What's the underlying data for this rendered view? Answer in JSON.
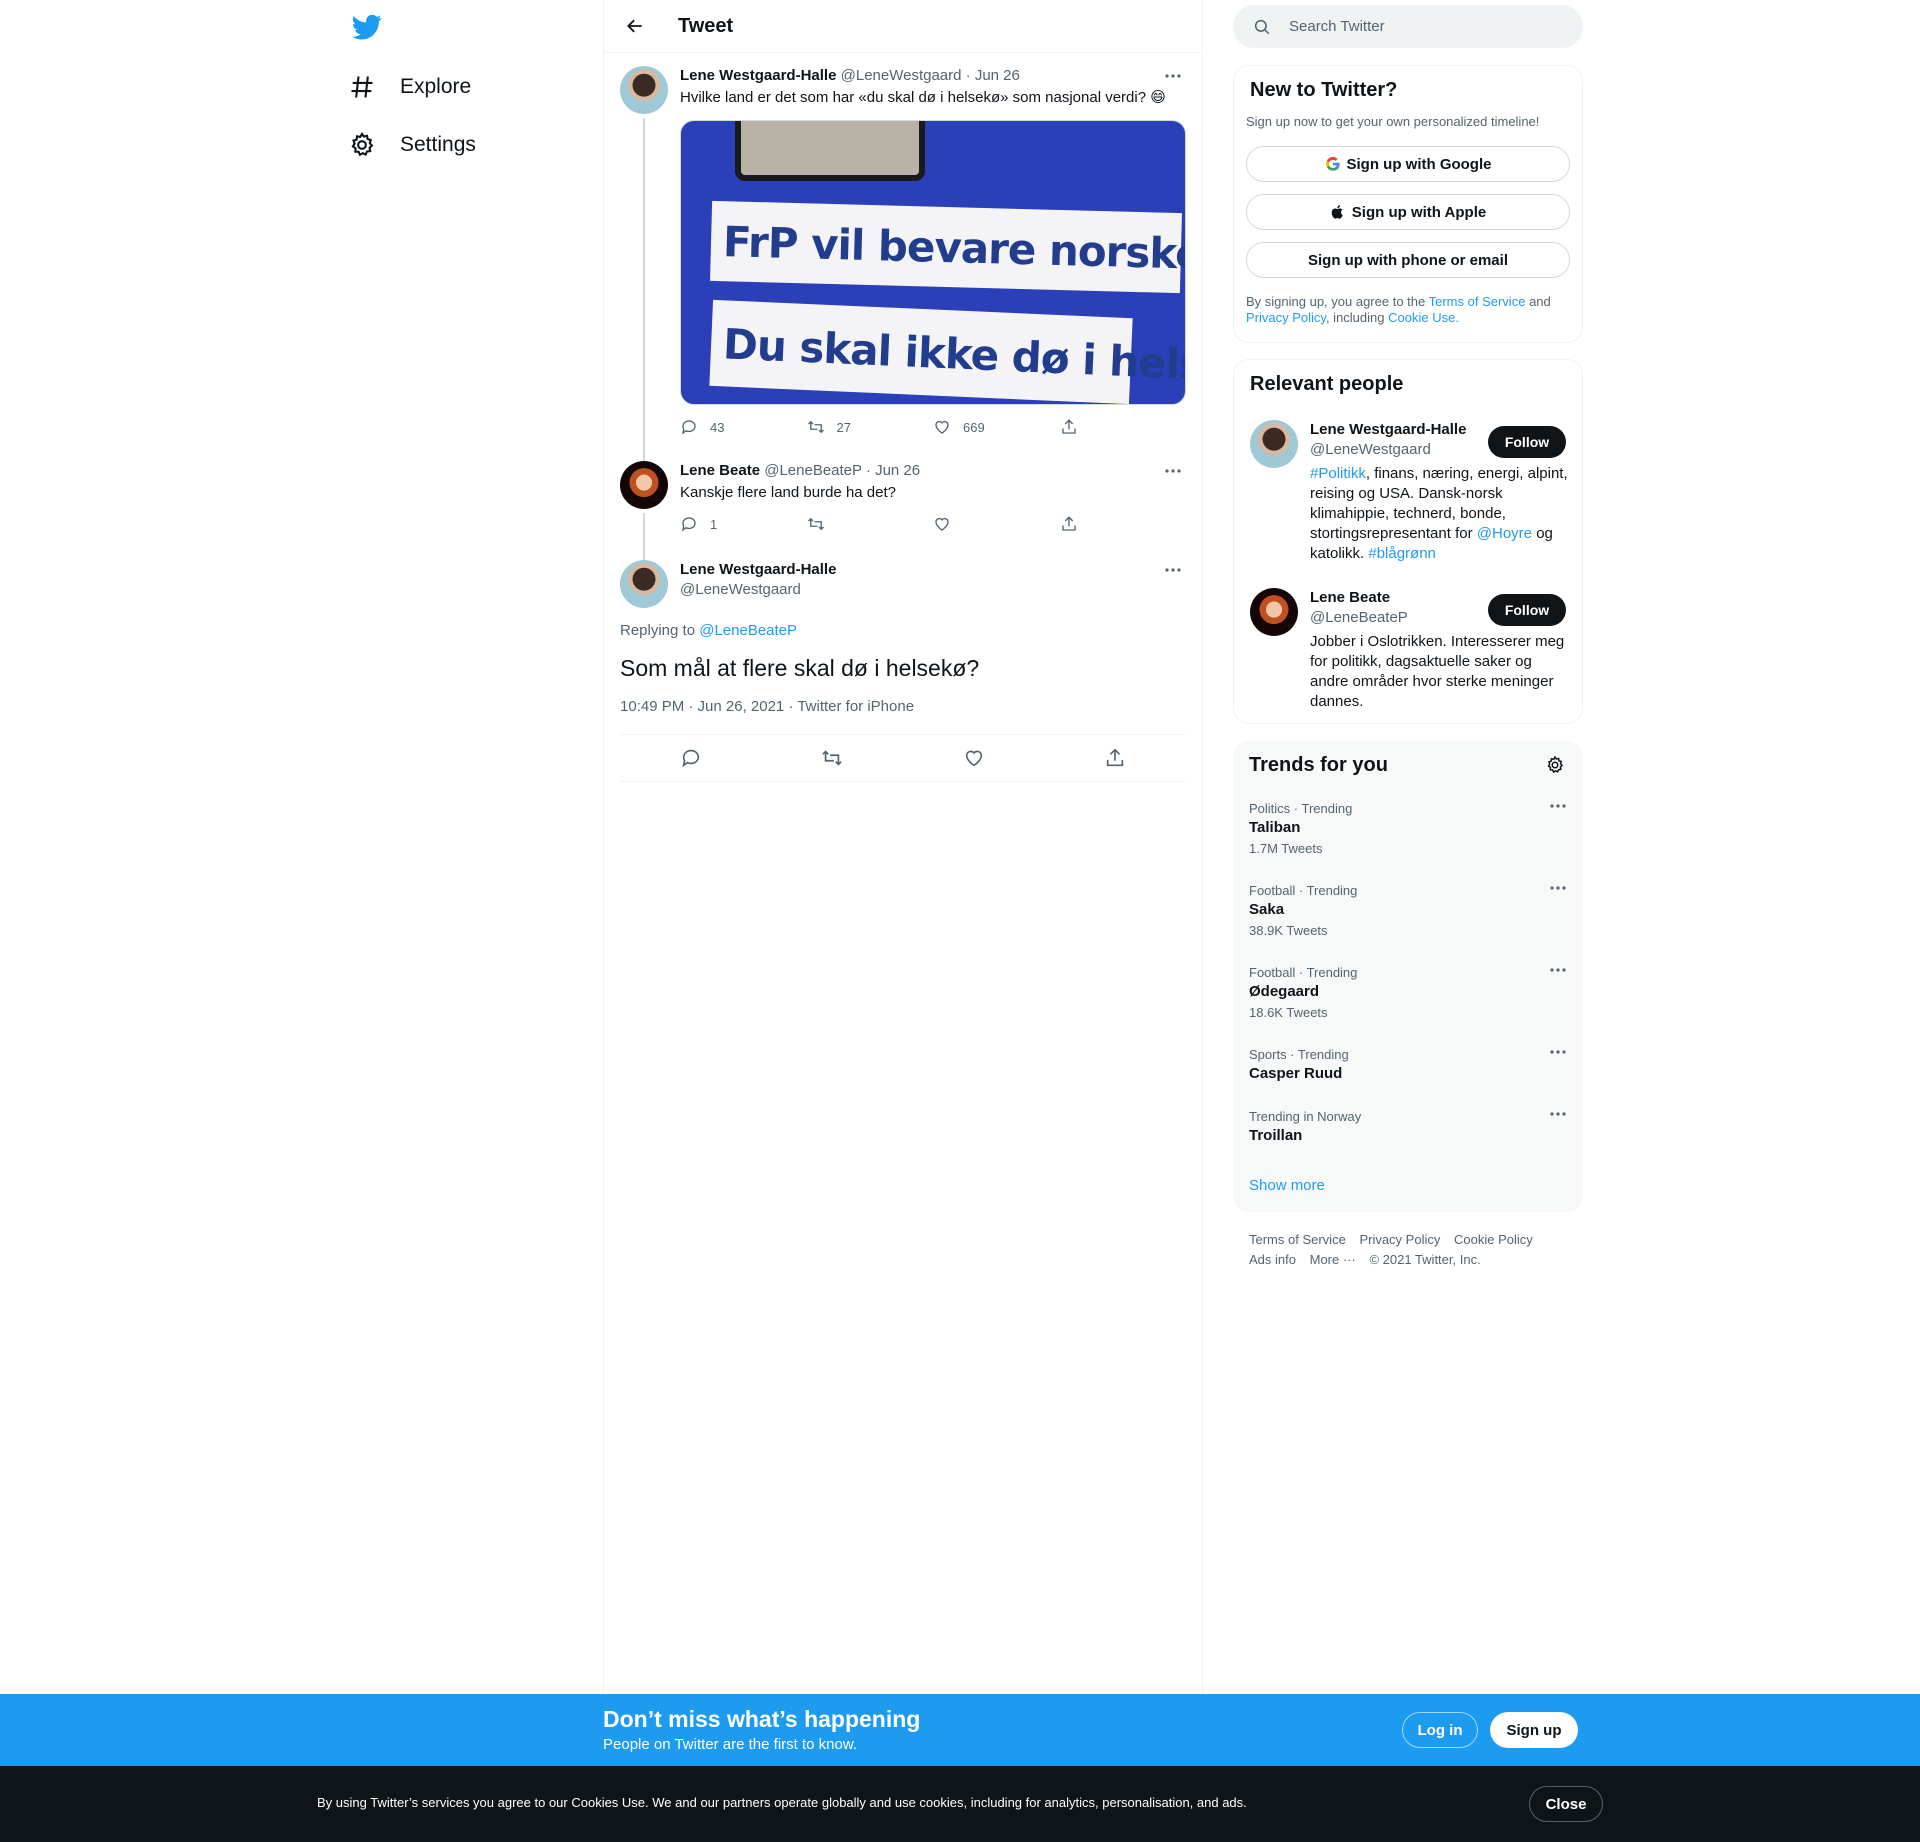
{
  "nav": {
    "logo": "twitter-bird-icon",
    "items": [
      {
        "label": "Explore",
        "icon": "hashtag-icon"
      },
      {
        "label": "Settings",
        "icon": "gear-icon"
      }
    ]
  },
  "header": {
    "title": "Tweet"
  },
  "tweets": [
    {
      "name": "Lene Westgaard-Halle",
      "handle": "@LeneWestgaard",
      "date": "· Jun 26",
      "text": "Hvilke land er det som har «du skal dø i helsekø» som nasjonal verdi? 😄",
      "image_text": [
        "FrP vil bevare norske verdier",
        "Du skal ikke dø i helsekø"
      ],
      "replies": "43",
      "retweets": "27",
      "likes": "669"
    },
    {
      "name": "Lene Beate",
      "handle": "@LeneBeateP",
      "date": "· Jun 26",
      "text": "Kanskje flere land burde ha det?",
      "replies": "1"
    }
  ],
  "main_tweet": {
    "name": "Lene Westgaard-Halle",
    "handle": "@LeneWestgaard",
    "replying_prefix": "Replying to",
    "replying_to": "@LeneBeateP",
    "text": "Som mål at flere skal dø i helsekø?",
    "timestamp": "10:49 PM · Jun 26, 2021 · Twitter for iPhone"
  },
  "search": {
    "placeholder": "Search Twitter"
  },
  "new_to_twitter": {
    "title": "New to Twitter?",
    "subtitle": "Sign up now to get your own personalized timeline!",
    "google": "Sign up with Google",
    "apple": "Sign up with Apple",
    "phone": "Sign up with phone or email",
    "legal_1": "By signing up, you agree to the",
    "terms": "Terms of Service",
    "legal_2": "and",
    "privacy": "Privacy Policy",
    "legal_3": ", including",
    "cookie": "Cookie Use."
  },
  "relevant_people": {
    "title": "Relevant people",
    "follow_label": "Follow",
    "people": [
      {
        "name": "Lene Westgaard-Halle",
        "handle": "@LeneWestgaard",
        "bio_tag1": "#Politikk",
        "bio_1": ", finans, næring, energi, alpint, reising og USA. Dansk-norsk klimahippie, technerd, bonde, stortingsrepresentant for",
        "bio_mention": "@Hoyre",
        "bio_2": "og katolikk.",
        "bio_tag2": "#blågrønn"
      },
      {
        "name": "Lene Beate",
        "handle": "@LeneBeateP",
        "bio": "Jobber i Oslotrikken. Interesserer meg for politikk, dagsaktuelle saker og andre områder hvor sterke meninger dannes."
      }
    ]
  },
  "trends": {
    "title": "Trends for you",
    "items": [
      {
        "context": "Politics · Trending",
        "name": "Taliban",
        "count": "1.7M Tweets"
      },
      {
        "context": "Football · Trending",
        "name": "Saka",
        "count": "38.9K Tweets"
      },
      {
        "context": "Football · Trending",
        "name": "Ødegaard",
        "count": "18.6K Tweets"
      },
      {
        "context": "Sports · Trending",
        "name": "Casper Ruud",
        "count": ""
      },
      {
        "context": "Trending in Norway",
        "name": "Troillan",
        "count": ""
      }
    ],
    "show_more": "Show more"
  },
  "footer": {
    "links": [
      "Terms of Service",
      "Privacy Policy",
      "Cookie Policy",
      "Ads info",
      "More ···"
    ],
    "copyright": "© 2021 Twitter, Inc."
  },
  "signup_banner": {
    "title": "Don’t miss what’s happening",
    "subtitle": "People on Twitter are the first to know.",
    "login": "Log in",
    "signup": "Sign up"
  },
  "cookie_banner": {
    "text": "By using Twitter’s services you agree to our Cookies Use. We and our partners operate globally and use cookies, including for analytics, personalisation, and ads.",
    "close": "Close"
  },
  "colors": {
    "accent": "#1d9bf0",
    "text": "#0f1419",
    "muted": "#536471",
    "border": "#eff3f4",
    "dark": "#0f1419"
  }
}
